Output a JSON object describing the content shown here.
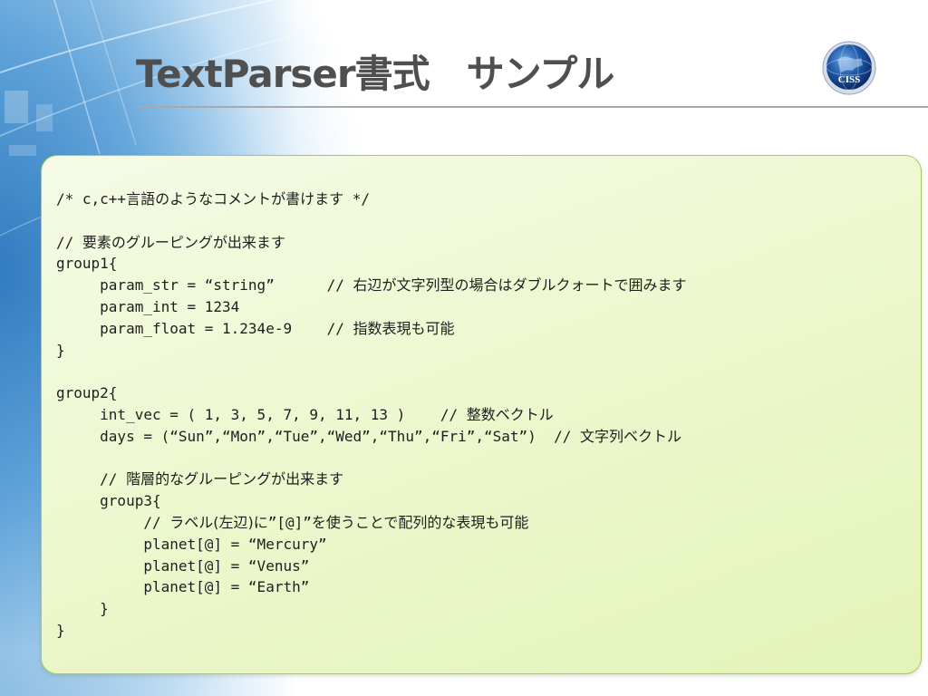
{
  "slide": {
    "title": "TextParser書式　サンプル",
    "logo_text": "CISS"
  },
  "colors": {
    "title": "#4f4f4f",
    "panel_border": "#a6c86a",
    "panel_fill": "#eef8d2",
    "code_text": "#1e1e1e",
    "accent_blue": "#2d78be"
  },
  "code": {
    "lines": [
      [
        {
          "t": "/* c,c++",
          "f": "mono"
        },
        {
          "t": "言語のようなコメントが書けます",
          "f": "jp"
        },
        {
          "t": " */",
          "f": "mono"
        }
      ],
      [],
      [
        {
          "t": "// ",
          "f": "mono"
        },
        {
          "t": "要素のグルーピングが出来ます",
          "f": "jp"
        }
      ],
      [
        {
          "t": "group1{",
          "f": "mono"
        }
      ],
      [
        {
          "t": "     param_str = “string”      // ",
          "f": "mono"
        },
        {
          "t": "右辺が文字列型の場合はダブルクォートで囲みます",
          "f": "jp"
        }
      ],
      [
        {
          "t": "     param_int = 1234",
          "f": "mono"
        }
      ],
      [
        {
          "t": "     param_float = 1.234e-9    // ",
          "f": "mono"
        },
        {
          "t": "指数表現も可能",
          "f": "jp"
        }
      ],
      [
        {
          "t": "}",
          "f": "mono"
        }
      ],
      [],
      [
        {
          "t": "group2{",
          "f": "mono"
        }
      ],
      [
        {
          "t": "     int_vec = ( 1, 3, 5, 7, 9, 11, 13 )    // ",
          "f": "mono"
        },
        {
          "t": "整数ベクトル",
          "f": "jp"
        }
      ],
      [
        {
          "t": "     days = (“Sun”,“Mon”,“Tue”,“Wed”,“Thu”,“Fri”,“Sat”)  // ",
          "f": "mono"
        },
        {
          "t": "文字列ベクトル",
          "f": "jp"
        }
      ],
      [],
      [
        {
          "t": "     // ",
          "f": "mono"
        },
        {
          "t": "階層的なグルーピングが出来ます",
          "f": "jp"
        }
      ],
      [
        {
          "t": "     group3{",
          "f": "mono"
        }
      ],
      [
        {
          "t": "          // ",
          "f": "mono"
        },
        {
          "t": "ラベル(左辺)に",
          "f": "jp"
        },
        {
          "t": "”[@]”",
          "f": "mono"
        },
        {
          "t": "を使うことで配列的な表現も可能",
          "f": "jp"
        }
      ],
      [
        {
          "t": "          planet[@] = “Mercury”",
          "f": "mono"
        }
      ],
      [
        {
          "t": "          planet[@] = “Venus”",
          "f": "mono"
        }
      ],
      [
        {
          "t": "          planet[@] = “Earth”",
          "f": "mono"
        }
      ],
      [
        {
          "t": "     }",
          "f": "mono"
        }
      ],
      [
        {
          "t": "}",
          "f": "mono"
        }
      ]
    ]
  }
}
